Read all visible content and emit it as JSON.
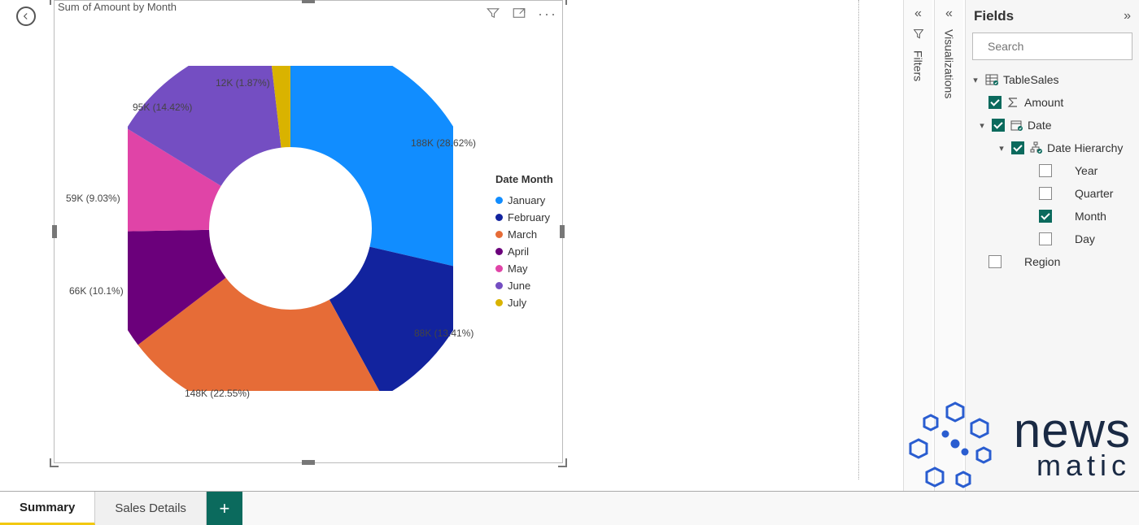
{
  "chart_data": {
    "type": "pie",
    "title": "Sum of Amount by Month",
    "legend_title": "Date Month",
    "series": [
      {
        "name": "January",
        "value": 188000,
        "label": "188K (28.62%)",
        "percent": 28.62,
        "color": "#118DFF"
      },
      {
        "name": "February",
        "value": 88000,
        "label": "88K (13.41%)",
        "percent": 13.41,
        "color": "#12239E"
      },
      {
        "name": "March",
        "value": 148000,
        "label": "148K (22.55%)",
        "percent": 22.55,
        "color": "#E66C37"
      },
      {
        "name": "April",
        "value": 66000,
        "label": "66K (10.1%)",
        "percent": 10.1,
        "color": "#6B007B"
      },
      {
        "name": "May",
        "value": 59000,
        "label": "59K (9.03%)",
        "percent": 9.03,
        "color": "#E044A7"
      },
      {
        "name": "June",
        "value": 95000,
        "label": "95K (14.42%)",
        "percent": 14.42,
        "color": "#744EC2"
      },
      {
        "name": "July",
        "value": 12000,
        "label": "12K (1.87%)",
        "percent": 1.87,
        "color": "#D9B300"
      }
    ]
  },
  "visual_toolbar": {
    "filter_tip": "Filter",
    "focus_tip": "Focus mode",
    "more_tip": "More options"
  },
  "rails": {
    "filters": "Filters",
    "visualizations": "Visualizations"
  },
  "fields_panel": {
    "title": "Fields",
    "search_placeholder": "Search",
    "tree": {
      "table": "TableSales",
      "amount": "Amount",
      "date": "Date",
      "hierarchy": "Date Hierarchy",
      "year": "Year",
      "quarter": "Quarter",
      "month": "Month",
      "day": "Day",
      "region": "Region"
    }
  },
  "page_tabs": {
    "tabs": [
      "Summary",
      "Sales Details"
    ],
    "active": 0,
    "add_tip": "New page"
  },
  "watermark": {
    "line1": "news",
    "line2": "matic"
  }
}
